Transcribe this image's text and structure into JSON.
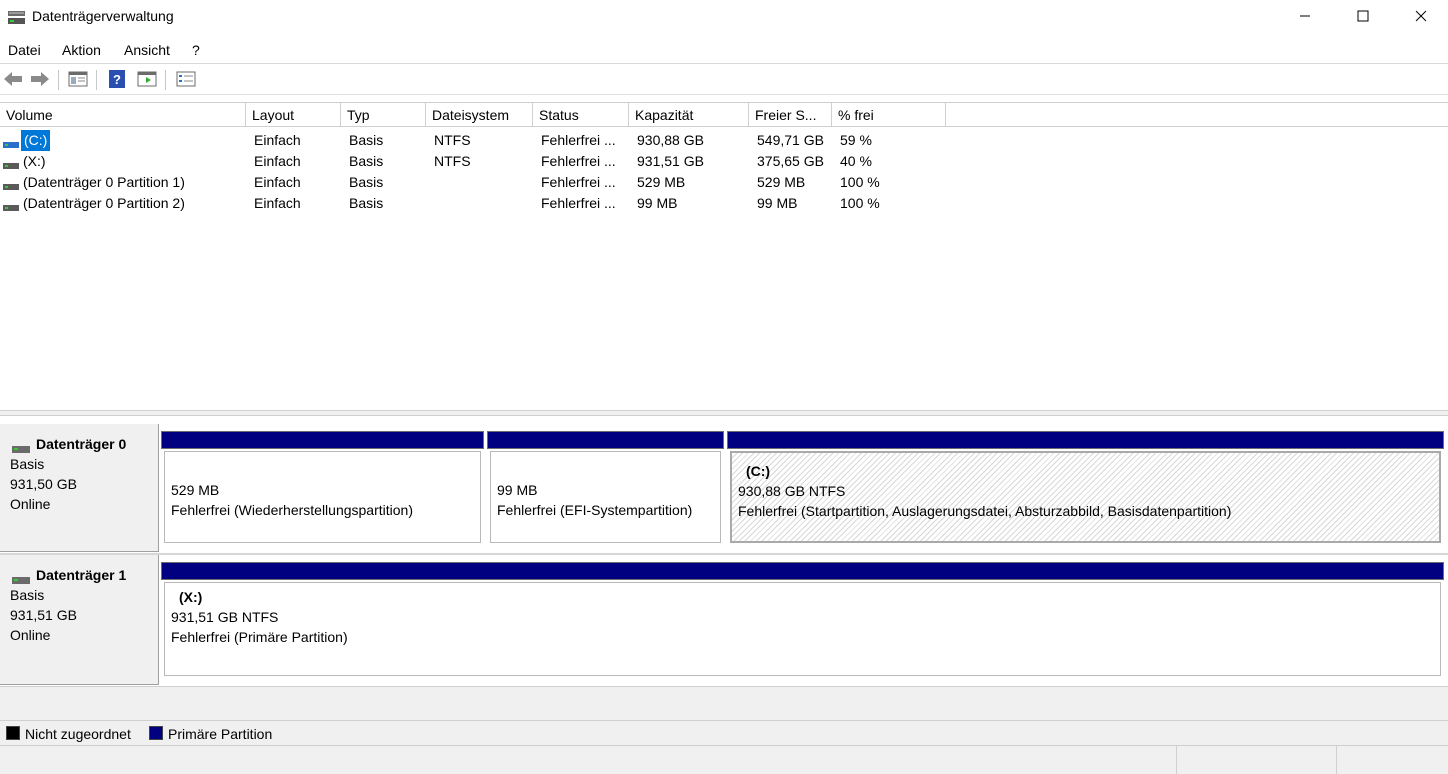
{
  "window": {
    "title": "Datenträgerverwaltung",
    "minimize_icon": "minimize-icon",
    "maximize_icon": "maximize-icon",
    "close_icon": "close-icon"
  },
  "menu": {
    "items": [
      "Datei",
      "Aktion",
      "Ansicht",
      "?"
    ]
  },
  "toolbar": {
    "icons": [
      "back-arrow-icon",
      "forward-arrow-icon",
      "properties-view-icon",
      "help-icon",
      "console-view-icon",
      "settings-list-icon"
    ]
  },
  "volume_list": {
    "columns": [
      "Volume",
      "Layout",
      "Typ",
      "Dateisystem",
      "Status",
      "Kapazität",
      "Freier S...",
      "% frei"
    ],
    "rows": [
      {
        "volume": "(C:)",
        "layout": "Einfach",
        "typ": "Basis",
        "fs": "NTFS",
        "status": "Fehlerfrei ...",
        "capacity": "930,88 GB",
        "free": "549,71 GB",
        "pct": "59 %",
        "selected": true
      },
      {
        "volume": "(X:)",
        "layout": "Einfach",
        "typ": "Basis",
        "fs": "NTFS",
        "status": "Fehlerfrei ...",
        "capacity": "931,51 GB",
        "free": "375,65 GB",
        "pct": "40 %",
        "selected": false
      },
      {
        "volume": "(Datenträger 0 Partition 1)",
        "layout": "Einfach",
        "typ": "Basis",
        "fs": "",
        "status": "Fehlerfrei ...",
        "capacity": "529 MB",
        "free": "529 MB",
        "pct": "100 %",
        "selected": false
      },
      {
        "volume": "(Datenträger 0 Partition 2)",
        "layout": "Einfach",
        "typ": "Basis",
        "fs": "",
        "status": "Fehlerfrei ...",
        "capacity": "99 MB",
        "free": "99 MB",
        "pct": "100 %",
        "selected": false
      }
    ]
  },
  "disks": [
    {
      "name": "Datenträger 0",
      "type": "Basis",
      "size": "931,50 GB",
      "state": "Online",
      "partitions": [
        {
          "name": "",
          "size": "529 MB",
          "status": "Fehlerfrei (Wiederherstellungspartition)"
        },
        {
          "name": "",
          "size": "99 MB",
          "status": "Fehlerfrei (EFI-Systempartition)"
        },
        {
          "name": "(C:)",
          "size": "930,88 GB NTFS",
          "status": "Fehlerfrei (Startpartition, Auslagerungsdatei, Absturzabbild, Basisdatenpartition)"
        }
      ]
    },
    {
      "name": "Datenträger 1",
      "type": "Basis",
      "size": "931,51 GB",
      "state": "Online",
      "partitions": [
        {
          "name": "(X:)",
          "size": "931,51 GB NTFS",
          "status": "Fehlerfrei (Primäre Partition)"
        }
      ]
    }
  ],
  "legend": {
    "unallocated": "Nicht zugeordnet",
    "primary": "Primäre Partition",
    "unallocated_color": "#000000",
    "primary_color": "#000080"
  },
  "colors": {
    "selection": "#0078d7",
    "partition_bar": "#000080"
  }
}
